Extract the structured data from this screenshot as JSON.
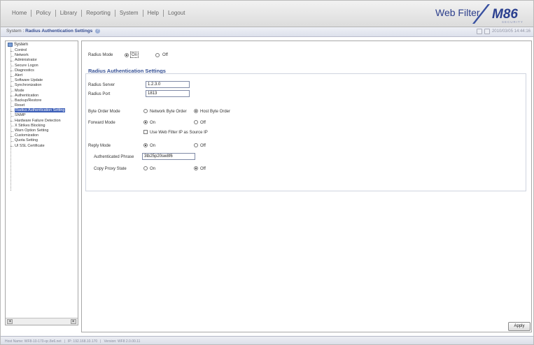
{
  "menu": {
    "items": [
      "Home",
      "Policy",
      "Library",
      "Reporting",
      "System",
      "Help",
      "Logout"
    ]
  },
  "app_title": "Web Filter",
  "logo": {
    "name": "M86",
    "sub": "SECURITY"
  },
  "breadcrumb": {
    "system": "System",
    "separator": " : ",
    "page": "Radius Authentication Settings"
  },
  "timestamp": "2010/03/05 14:44:16",
  "tree": {
    "root": "System",
    "items": [
      "Control",
      "Network",
      "Administrator",
      "Secure Logon",
      "Diagnostics",
      "Alert",
      "Software Update",
      "Synchronization",
      "Mode",
      "Authentication",
      "Backup/Restore",
      "Reset",
      "Radius Authentication Setting",
      "SNMP",
      "Hardware Failure Detection",
      "X Strikes Blocking",
      "Warn Option Setting",
      "Customization",
      "Quota Setting",
      "UI SSL Certificate"
    ],
    "selected_index": 12
  },
  "form": {
    "radius_mode": {
      "label": "Radius Mode",
      "on": "On",
      "off": "Off",
      "selected": "on"
    },
    "section_title": "Radius Authentication Settings",
    "radius_server": {
      "label": "Radius Server",
      "value": "1.2.3.0"
    },
    "radius_port": {
      "label": "Radius Port",
      "value": "1813"
    },
    "byte_order": {
      "label": "Byte Order Mode",
      "network": "Network Byte Order",
      "host": "Host Byte Order",
      "selected": "host"
    },
    "forward_mode": {
      "label": "Forward Mode",
      "on": "On",
      "off": "Off",
      "selected": "on"
    },
    "use_web_filter_ip": {
      "label": "Use Web Filter IP as Source IP",
      "checked": false
    },
    "reply_mode": {
      "label": "Reply Mode",
      "on": "On",
      "off": "Off",
      "selected": "on"
    },
    "authenticated_phrase": {
      "label": "Authenticated Phrase",
      "value": "3tb25p20sw8f6"
    },
    "copy_proxy_state": {
      "label": "Copy Proxy State",
      "on": "On",
      "off": "Off",
      "selected": "off"
    }
  },
  "apply_label": "Apply",
  "status": {
    "host": "Host Name: WF8-10-170-qc.8e6.net",
    "ip": "IP: 192.168.10.170",
    "version": "Version: WF8 2.0.00.11"
  },
  "colors": {
    "accent": "#355094",
    "selection": "#3d5fb8"
  }
}
